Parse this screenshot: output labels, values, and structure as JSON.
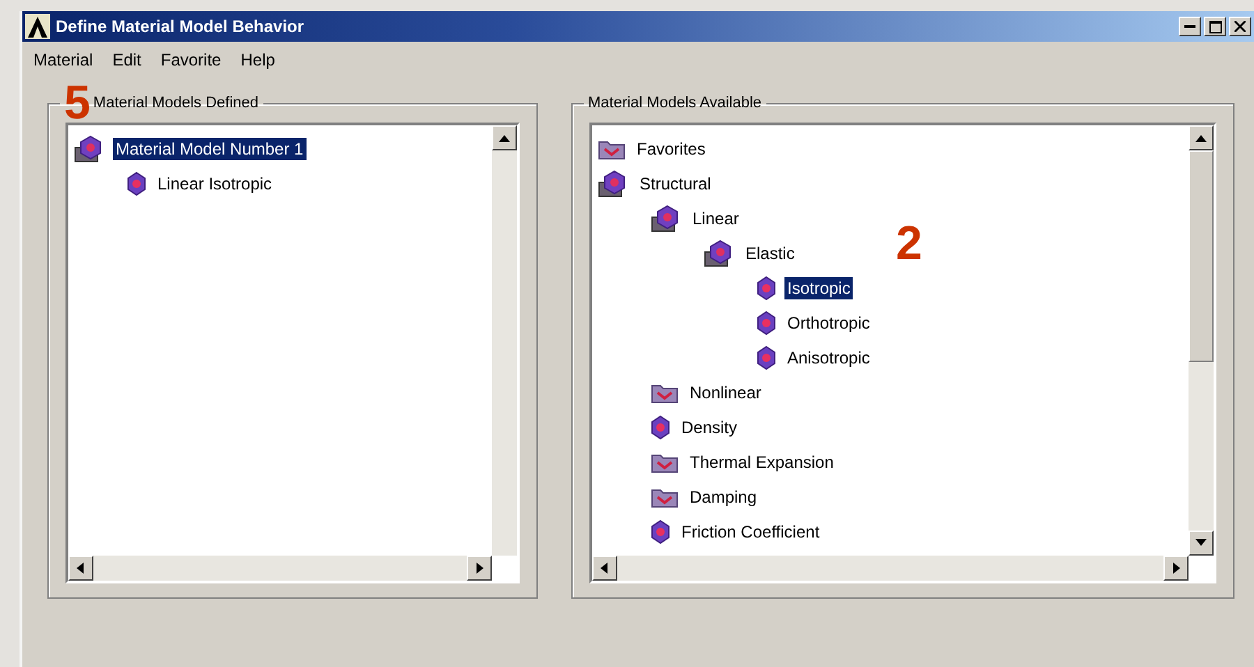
{
  "window": {
    "title": "Define Material Model Behavior"
  },
  "menu": [
    "Material",
    "Edit",
    "Favorite",
    "Help"
  ],
  "callouts": [
    "5",
    "2"
  ],
  "defined": {
    "label": "Material Models Defined",
    "tree": [
      {
        "label": "Material Model Number 1",
        "kind": "stack",
        "selected": true,
        "children": [
          {
            "label": "Linear Isotropic",
            "kind": "leaf",
            "selected": false
          }
        ]
      }
    ]
  },
  "available": {
    "label": "Material Models Available",
    "tree": [
      {
        "label": "Favorites",
        "kind": "folder",
        "selected": false
      },
      {
        "label": "Structural",
        "kind": "stack",
        "selected": false,
        "children": [
          {
            "label": "Linear",
            "kind": "stack",
            "selected": false,
            "children": [
              {
                "label": "Elastic",
                "kind": "stack",
                "selected": false,
                "children": [
                  {
                    "label": "Isotropic",
                    "kind": "leaf",
                    "selected": true
                  },
                  {
                    "label": "Orthotropic",
                    "kind": "leaf",
                    "selected": false
                  },
                  {
                    "label": "Anisotropic",
                    "kind": "leaf",
                    "selected": false
                  }
                ]
              }
            ]
          },
          {
            "label": "Nonlinear",
            "kind": "folder",
            "selected": false
          },
          {
            "label": "Density",
            "kind": "leaf",
            "selected": false
          },
          {
            "label": "Thermal Expansion",
            "kind": "folder",
            "selected": false
          },
          {
            "label": "Damping",
            "kind": "folder",
            "selected": false
          },
          {
            "label": "Friction Coefficient",
            "kind": "leaf",
            "selected": false
          }
        ]
      }
    ]
  }
}
